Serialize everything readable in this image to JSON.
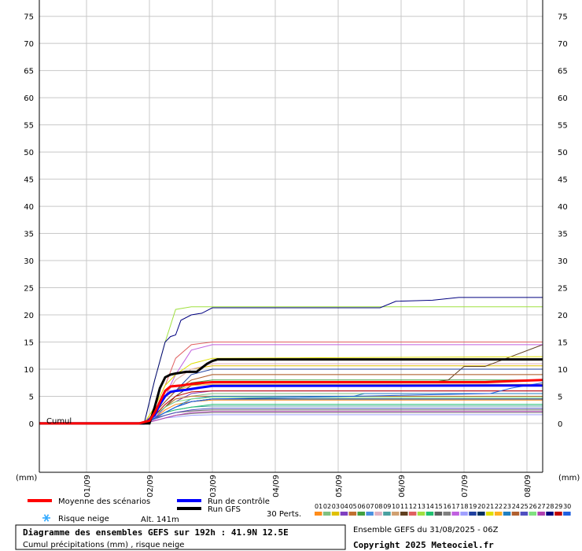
{
  "chart_data": {
    "type": "line",
    "y_left_ticks": [
      0,
      5,
      10,
      15,
      20,
      25,
      30,
      35,
      40,
      45,
      50,
      55,
      60,
      65,
      70,
      75
    ],
    "ylim": [
      -9,
      78
    ],
    "x_labels": [
      "01/09",
      "02/09",
      "03/09",
      "04/09",
      "05/09",
      "06/09",
      "07/09",
      "08/09"
    ],
    "x_label_hours": [
      18,
      42,
      66,
      90,
      114,
      138,
      162,
      186
    ],
    "xlim": [
      0,
      192
    ],
    "unit_label": "(mm)",
    "cumul_label": "Cumul",
    "grid": true,
    "series": [
      {
        "name": "Moyenne des scénarios",
        "color": "#ff0000",
        "width": 3,
        "x": [
          0,
          38,
          42,
          44,
          46,
          48,
          50,
          54,
          60,
          66,
          78,
          100,
          150,
          170,
          180,
          192
        ],
        "y": [
          0,
          0,
          0.5,
          2,
          4,
          6,
          6.8,
          7,
          7.4,
          7.6,
          7.6,
          7.6,
          7.6,
          7.6,
          7.8,
          8
        ]
      },
      {
        "name": "Run de contrôle",
        "color": "#0000ff",
        "width": 3,
        "x": [
          0,
          40,
          44,
          46,
          48,
          50,
          52,
          56,
          60,
          66,
          192
        ],
        "y": [
          0,
          0,
          1.5,
          3.5,
          5,
          5.8,
          6,
          6.2,
          6.5,
          6.9,
          7
        ]
      },
      {
        "name": "Run GFS",
        "color": "#000000",
        "width": 3,
        "x": [
          0,
          42,
          44,
          46,
          48,
          50,
          52,
          56,
          60,
          64,
          66,
          68,
          192
        ],
        "y": [
          0,
          0,
          3,
          6.5,
          8.5,
          9,
          9.2,
          9.5,
          9.5,
          11,
          11.5,
          11.8,
          11.8
        ]
      }
    ],
    "perturbations": [
      {
        "id": "01",
        "color": "#ff8c1a",
        "x": [
          0,
          40,
          44,
          48,
          52,
          58,
          66,
          192
        ],
        "y": [
          0,
          0,
          1,
          2.5,
          3.5,
          4,
          4.3,
          4.3
        ]
      },
      {
        "id": "02",
        "color": "#80c080",
        "x": [
          0,
          40,
          44,
          48,
          52,
          58,
          66,
          192
        ],
        "y": [
          0,
          0,
          1.5,
          3,
          4.5,
          5,
          5.5,
          5.5
        ]
      },
      {
        "id": "03",
        "color": "#e0c000",
        "x": [
          0,
          40,
          44,
          48,
          52,
          58,
          66,
          192
        ],
        "y": [
          0,
          0,
          2,
          5,
          8,
          10,
          10.6,
          10.6
        ]
      },
      {
        "id": "04",
        "color": "#8040c0",
        "x": [
          0,
          40,
          44,
          48,
          52,
          58,
          66,
          192
        ],
        "y": [
          0,
          0,
          1,
          3,
          4,
          5.5,
          6,
          6
        ]
      },
      {
        "id": "05",
        "color": "#c07030",
        "x": [
          0,
          40,
          44,
          48,
          52,
          58,
          66,
          192
        ],
        "y": [
          0,
          0,
          1.5,
          3,
          4.5,
          5,
          5,
          5
        ]
      },
      {
        "id": "06",
        "color": "#40a040",
        "x": [
          0,
          40,
          44,
          48,
          52,
          58,
          66,
          192
        ],
        "y": [
          0,
          0,
          2,
          4,
          6,
          7.5,
          8,
          8
        ]
      },
      {
        "id": "07",
        "color": "#4a90e0",
        "x": [
          0,
          40,
          44,
          48,
          52,
          58,
          66,
          192
        ],
        "y": [
          0,
          0,
          1,
          2,
          3,
          4,
          4.5,
          4.5
        ]
      },
      {
        "id": "08",
        "color": "#e0b0c0",
        "x": [
          0,
          40,
          44,
          48,
          52,
          58,
          66,
          192
        ],
        "y": [
          0,
          0,
          2,
          5,
          8,
          10,
          11,
          11
        ]
      },
      {
        "id": "09",
        "color": "#4aa0a0",
        "x": [
          0,
          40,
          44,
          48,
          52,
          58,
          66,
          192
        ],
        "y": [
          0,
          0,
          1,
          2,
          2.5,
          3,
          3.2,
          3.2
        ]
      },
      {
        "id": "10",
        "color": "#d0a070",
        "x": [
          0,
          40,
          44,
          48,
          52,
          58,
          66,
          192
        ],
        "y": [
          0,
          0,
          2,
          4,
          6,
          8,
          9,
          9
        ]
      },
      {
        "id": "11",
        "color": "#604020",
        "x": [
          0,
          40,
          44,
          48,
          52,
          58,
          66,
          150,
          156,
          162,
          170,
          192
        ],
        "y": [
          0,
          0,
          1.5,
          3,
          5,
          7,
          7.6,
          7.6,
          8,
          10.5,
          10.5,
          14.5
        ]
      },
      {
        "id": "12",
        "color": "#e06060",
        "x": [
          0,
          40,
          44,
          48,
          52,
          58,
          66,
          192
        ],
        "y": [
          0,
          0,
          3,
          7,
          12,
          14.5,
          15,
          15
        ]
      },
      {
        "id": "13",
        "color": "#a0e040",
        "x": [
          0,
          40,
          44,
          48,
          52,
          58,
          66,
          192
        ],
        "y": [
          0,
          0,
          8,
          15,
          21,
          21.5,
          21.5,
          21.5
        ]
      },
      {
        "id": "14",
        "color": "#20c070",
        "x": [
          0,
          40,
          44,
          48,
          52,
          58,
          66,
          192
        ],
        "y": [
          0,
          0,
          1,
          2,
          2.5,
          3,
          3.5,
          3.5
        ]
      },
      {
        "id": "15",
        "color": "#606060",
        "x": [
          0,
          40,
          44,
          48,
          52,
          58,
          66,
          192
        ],
        "y": [
          0,
          0,
          1,
          1.5,
          2,
          2.3,
          2.5,
          2.5
        ]
      },
      {
        "id": "16",
        "color": "#808080",
        "x": [
          0,
          40,
          44,
          48,
          52,
          58,
          66,
          192
        ],
        "y": [
          0,
          0,
          0.5,
          1,
          1.5,
          1.8,
          2,
          2
        ]
      },
      {
        "id": "17",
        "color": "#c060e0",
        "x": [
          0,
          40,
          44,
          48,
          52,
          58,
          66,
          192
        ],
        "y": [
          0,
          0,
          2,
          5,
          9,
          13.5,
          14.5,
          14.5
        ]
      },
      {
        "id": "18",
        "color": "#a0a0ff",
        "x": [
          0,
          40,
          44,
          48,
          52,
          58,
          66,
          192
        ],
        "y": [
          0,
          0,
          0.5,
          1,
          1.2,
          1.5,
          1.6,
          1.6
        ]
      },
      {
        "id": "19",
        "color": "#2040a0",
        "x": [
          0,
          40,
          44,
          48,
          52,
          58,
          66,
          192
        ],
        "y": [
          0,
          0,
          2,
          4,
          6,
          9,
          10,
          10
        ]
      },
      {
        "id": "20",
        "color": "#003060",
        "x": [
          0,
          40,
          44,
          48,
          52,
          58,
          66,
          192
        ],
        "y": [
          0,
          0,
          1,
          2,
          3,
          4,
          4.5,
          4.5
        ]
      },
      {
        "id": "21",
        "color": "#e0e000",
        "x": [
          0,
          40,
          44,
          48,
          52,
          58,
          66,
          192
        ],
        "y": [
          0,
          0,
          3,
          7,
          9,
          11,
          12,
          12.3
        ]
      },
      {
        "id": "22",
        "color": "#ffb020",
        "x": [
          0,
          40,
          44,
          48,
          52,
          58,
          66,
          192
        ],
        "y": [
          0,
          0,
          2,
          5,
          6,
          7,
          7.2,
          7.2
        ]
      },
      {
        "id": "23",
        "color": "#2080c0",
        "x": [
          0,
          40,
          44,
          48,
          52,
          58,
          66,
          120,
          124,
          192
        ],
        "y": [
          0,
          0,
          1,
          2,
          3,
          4.5,
          5,
          5,
          5.5,
          5.5
        ]
      },
      {
        "id": "24",
        "color": "#b06030",
        "x": [
          0,
          40,
          44,
          48,
          52,
          58,
          66,
          192
        ],
        "y": [
          0,
          0,
          2,
          4,
          6,
          8,
          9,
          9
        ]
      },
      {
        "id": "25",
        "color": "#5050c0",
        "x": [
          0,
          40,
          44,
          48,
          52,
          58,
          66,
          192
        ],
        "y": [
          0,
          0,
          0.8,
          1.5,
          2,
          2.5,
          2.8,
          2.8
        ]
      },
      {
        "id": "26",
        "color": "#80e080",
        "x": [
          0,
          40,
          44,
          48,
          52,
          58,
          66,
          192
        ],
        "y": [
          0,
          0,
          1.5,
          3,
          4,
          4.5,
          4.8,
          4.8
        ]
      },
      {
        "id": "27",
        "color": "#b040b0",
        "x": [
          0,
          40,
          44,
          48,
          52,
          58,
          66,
          192
        ],
        "y": [
          0,
          0,
          0.5,
          1,
          1.5,
          2,
          2.2,
          2.2
        ]
      },
      {
        "id": "28",
        "color": "#000080",
        "x": [
          0,
          40,
          44,
          48,
          50,
          52,
          54,
          58,
          62,
          66,
          130,
          136,
          150,
          160,
          192
        ],
        "y": [
          0,
          0,
          8,
          15,
          16,
          16.3,
          19,
          20,
          20.3,
          21.3,
          21.3,
          22.5,
          22.7,
          23.2,
          23.2
        ]
      },
      {
        "id": "29",
        "color": "#c00000",
        "x": [
          0,
          40,
          44,
          48,
          52,
          58,
          66,
          192
        ],
        "y": [
          0,
          0,
          1.5,
          3.5,
          5,
          5.8,
          6,
          6
        ]
      },
      {
        "id": "30",
        "color": "#2060e0",
        "x": [
          0,
          40,
          44,
          48,
          52,
          58,
          66,
          172,
          180,
          192
        ],
        "y": [
          0,
          0,
          1,
          2,
          3,
          4,
          4.5,
          5.5,
          6.5,
          7.5
        ]
      }
    ]
  },
  "legend": {
    "mean_label": "Moyenne des scénarios",
    "control_label": "Run de contrôle",
    "gfs_label": "Run GFS",
    "snow_label": "Risque neige",
    "altitude": "Alt. 141m",
    "perts_label": "30 Perts."
  },
  "footer": {
    "title": "Diagramme des ensembles GEFS sur 192h : 41.9N 12.5E",
    "subtitle": "Cumul précipitations (mm) , risque neige",
    "run_info": "Ensemble GEFS du 31/08/2025 - 06Z",
    "copyright": "Copyright 2025 Meteociel.fr"
  },
  "colors": {
    "grid": "#c8c8c8",
    "mean": "#ff0000",
    "control": "#0000ff",
    "gfs": "#000000",
    "snow_icon": "#33aaff"
  },
  "icons": {
    "snow": "snowflake-icon"
  }
}
